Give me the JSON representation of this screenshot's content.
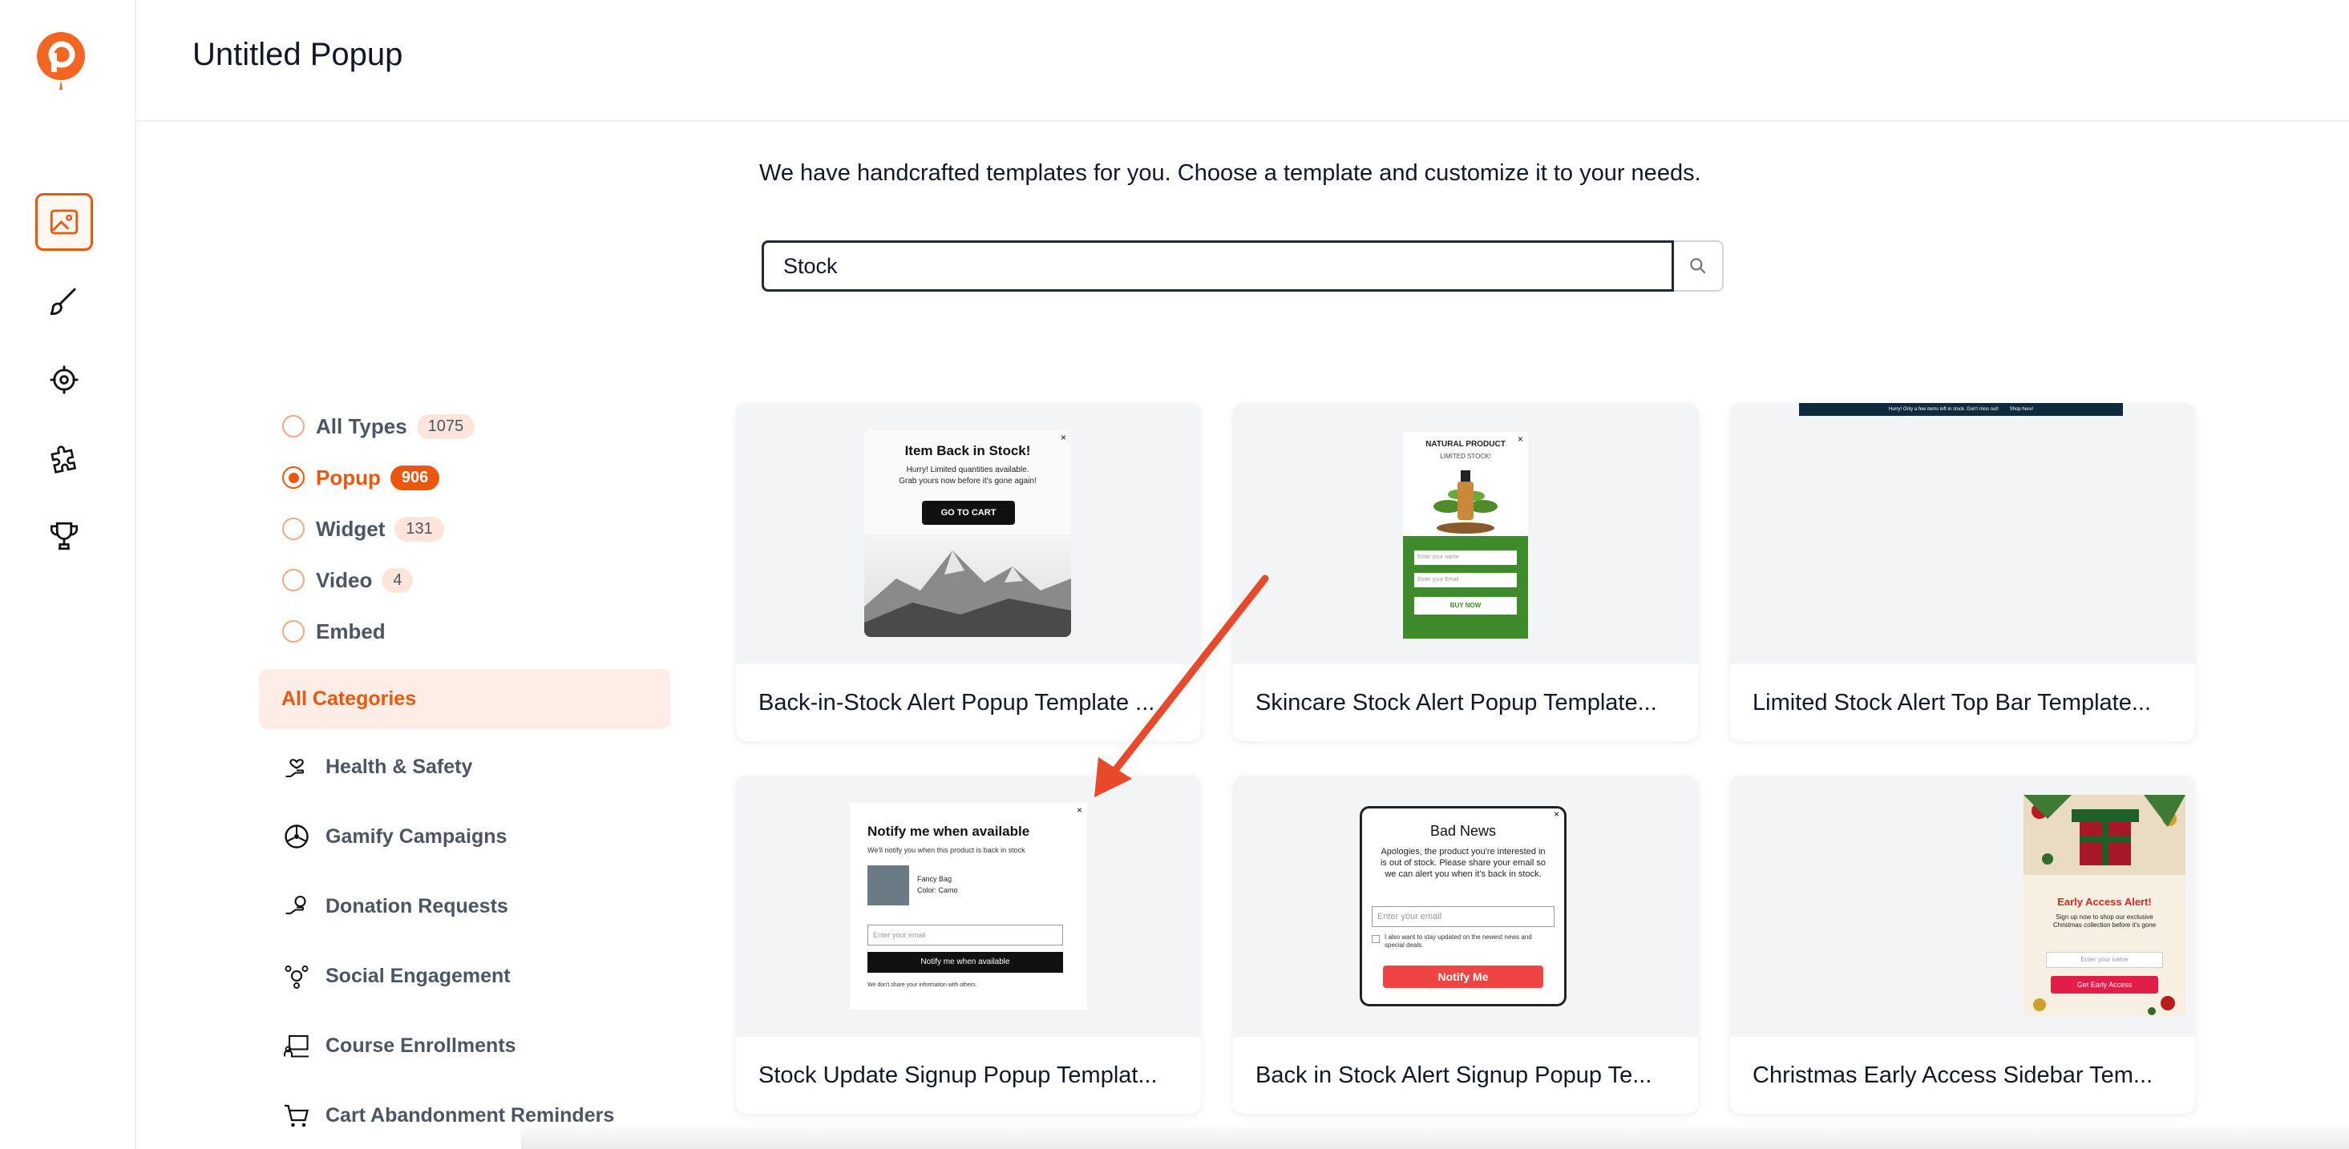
{
  "app": {
    "title": "Untitled Popup"
  },
  "rail": {
    "items": [
      {
        "icon": "image-icon",
        "active": true
      },
      {
        "icon": "brush-icon",
        "active": false
      },
      {
        "icon": "target-icon",
        "active": false
      },
      {
        "icon": "puzzle-icon",
        "active": false
      },
      {
        "icon": "trophy-icon",
        "active": false
      }
    ]
  },
  "intro": "We have handcrafted templates for you. Choose a template and customize it to your needs.",
  "search": {
    "value": "Stock",
    "placeholder": ""
  },
  "types": [
    {
      "label": "All Types",
      "count": "1075",
      "selected": false
    },
    {
      "label": "Popup",
      "count": "906",
      "selected": true
    },
    {
      "label": "Widget",
      "count": "131",
      "selected": false
    },
    {
      "label": "Video",
      "count": "4",
      "selected": false
    },
    {
      "label": "Embed",
      "count": "",
      "selected": false
    }
  ],
  "all_categories": "All Categories",
  "categories": [
    {
      "label": "Health & Safety",
      "icon": "hand-heart-icon"
    },
    {
      "label": "Gamify Campaigns",
      "icon": "wheel-icon"
    },
    {
      "label": "Donation Requests",
      "icon": "donation-icon"
    },
    {
      "label": "Social Engagement",
      "icon": "social-icon"
    },
    {
      "label": "Course Enrollments",
      "icon": "course-icon"
    },
    {
      "label": "Cart Abandonment Reminders",
      "icon": "cart-icon"
    }
  ],
  "cards": [
    {
      "title": "Back-in-Stock Alert Popup Template ...",
      "preview": {
        "heading": "Item Back in Stock!",
        "line1": "Hurry! Limited quantities available.",
        "line2": "Grab yours now before it's gone again!",
        "button": "GO TO CART"
      }
    },
    {
      "title": "Skincare Stock Alert Popup Template...",
      "preview": {
        "heading": "NATURAL PRODUCT",
        "sub": "LIMITED STOCK!",
        "field1": "Enter your name",
        "field2": "Enter your Email",
        "button": "BUY NOW"
      }
    },
    {
      "title": "Limited Stock Alert Top Bar Template...",
      "preview": {
        "bar_text": "Hurry! Only a few items left in stock. Don't miss out!",
        "bar_button": "Shop here!"
      }
    },
    {
      "title": "Stock Update Signup Popup Templat...",
      "preview": {
        "heading": "Notify me when available",
        "line1": "We'll notify you when this product is back in stock",
        "product": "Fancy Bag",
        "color": "Color: Camo",
        "field": "Enter your email",
        "button": "Notify me when available",
        "foot": "We don't share your information with others."
      }
    },
    {
      "title": "Back in Stock Alert Signup Popup Te...",
      "preview": {
        "heading": "Bad News",
        "body": "Apologies, the product you're interested in is out of stock. Please share your email so we can alert you when it's back in stock.",
        "field": "Enter your email",
        "check": "I also want to stay updated on the newest news and special deals.",
        "button": "Notify Me"
      }
    },
    {
      "title": "Christmas Early Access Sidebar Tem...",
      "preview": {
        "heading": "Early Access Alert!",
        "body": "Sign up now to shop our exclusive Christmas collection before it's gone",
        "field": "Enter your name",
        "button": "Get Early Access"
      }
    }
  ],
  "colors": {
    "accent": "#ea580c",
    "accent_soft": "#feece6",
    "arrow": "#e8492b"
  }
}
